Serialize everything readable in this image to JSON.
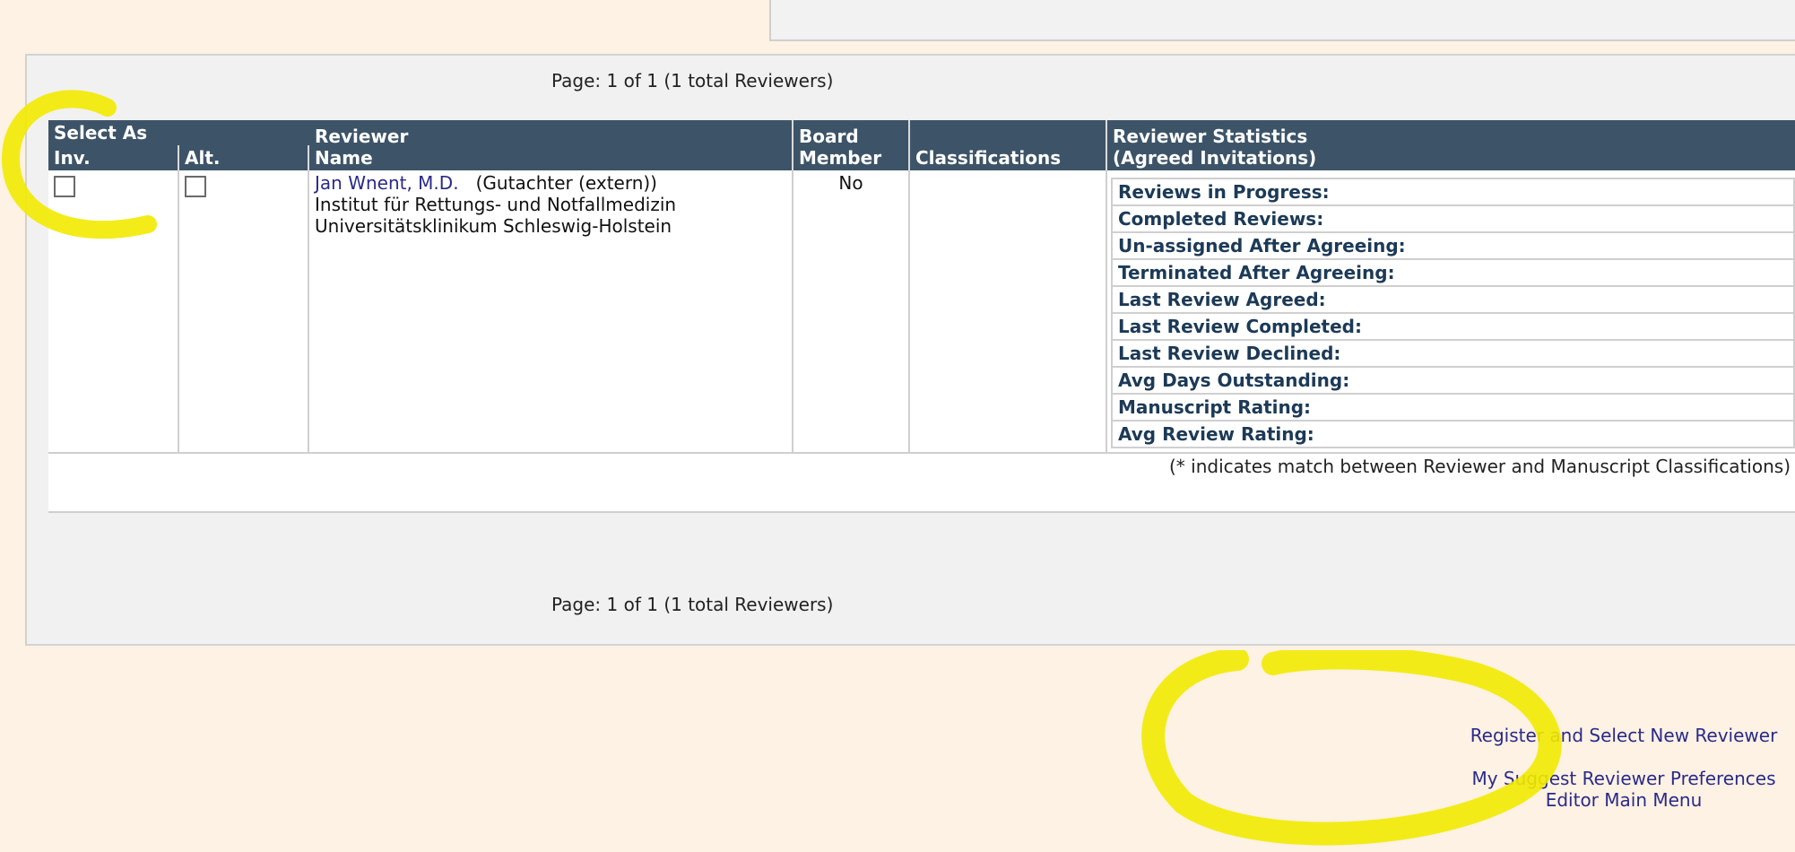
{
  "page_info_top": "Page: 1 of 1 (1 total Reviewers)",
  "page_info_bottom": "Page: 1 of 1 (1 total Reviewers)",
  "table": {
    "headers": {
      "select_as": "Select As",
      "inv": "Inv.",
      "alt": "Alt.",
      "reviewer_line1": "Reviewer",
      "reviewer_line2": "Name",
      "board_line1": "Board",
      "board_line2": "Member",
      "classifications": "Classifications",
      "stats_line1": "Reviewer Statistics",
      "stats_line2": "(Agreed Invitations)"
    },
    "row": {
      "name_link": "Jan Wnent, M.D.",
      "role": "(Gutachter (extern))",
      "institute": "Institut für Rettungs- und Notfallmedizin",
      "hospital": "Universitätsklinikum Schleswig-Holstein",
      "board_member": "No",
      "stats": [
        "Reviews in Progress:",
        "Completed Reviews:",
        "Un-assigned After Agreeing:",
        "Terminated After Agreeing:",
        "Last Review Agreed:",
        "Last Review Completed:",
        "Last Review Declined:",
        "Avg Days Outstanding:",
        "Manuscript Rating:",
        "Avg Review Rating:"
      ]
    },
    "match_note": "(* indicates match between Reviewer and Manuscript Classifications)"
  },
  "links": {
    "register": "Register and Select New Reviewer",
    "preferences": "My Suggest Reviewer Preferences",
    "main_menu": "Editor Main Menu"
  },
  "colors": {
    "header_bg": "#3d5468",
    "highlight": "#f2ea00",
    "link": "#2a2a8a"
  }
}
